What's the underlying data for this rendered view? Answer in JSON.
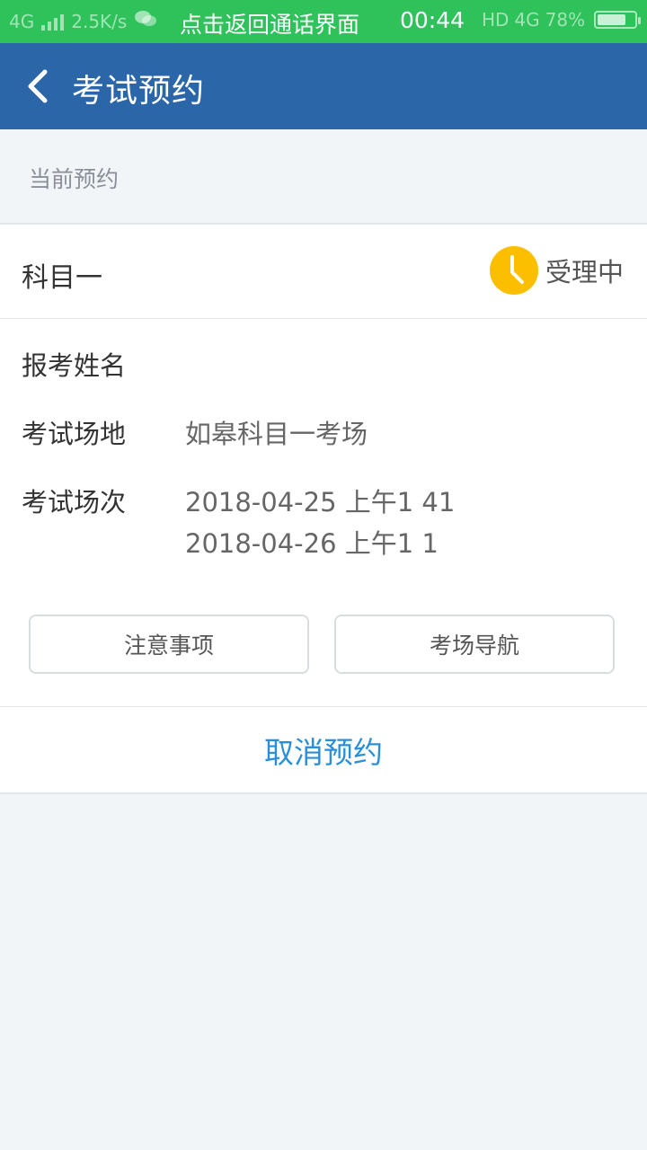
{
  "status_bar": {
    "network": "4G",
    "speed": "2.5K/s",
    "notice": "点击返回通话界面",
    "time": "00:44",
    "hd": "HD",
    "net_right": "4G",
    "battery": "78%",
    "battery_level": 0.78
  },
  "header": {
    "title": "考试预约"
  },
  "section": {
    "label": "当前预约"
  },
  "card": {
    "subject": "科目一",
    "status": "受理中",
    "fields": {
      "name_label": "报考姓名",
      "name_value": "",
      "venue_label": "考试场地",
      "venue_value": "如皋科目一考场",
      "session_label": "考试场次",
      "sessions": [
        "2018-04-25 上午1 41",
        "2018-04-26 上午1 1"
      ]
    },
    "buttons": {
      "notes": "注意事项",
      "navigation": "考场导航"
    },
    "cancel": "取消预约"
  },
  "colors": {
    "status_bar": "#2fc25b",
    "header": "#2b66a8",
    "status_icon": "#fcbf00",
    "cancel_link": "#2a8fd8"
  },
  "icons": {
    "back": "chevron-left-icon",
    "status": "clock-icon"
  }
}
